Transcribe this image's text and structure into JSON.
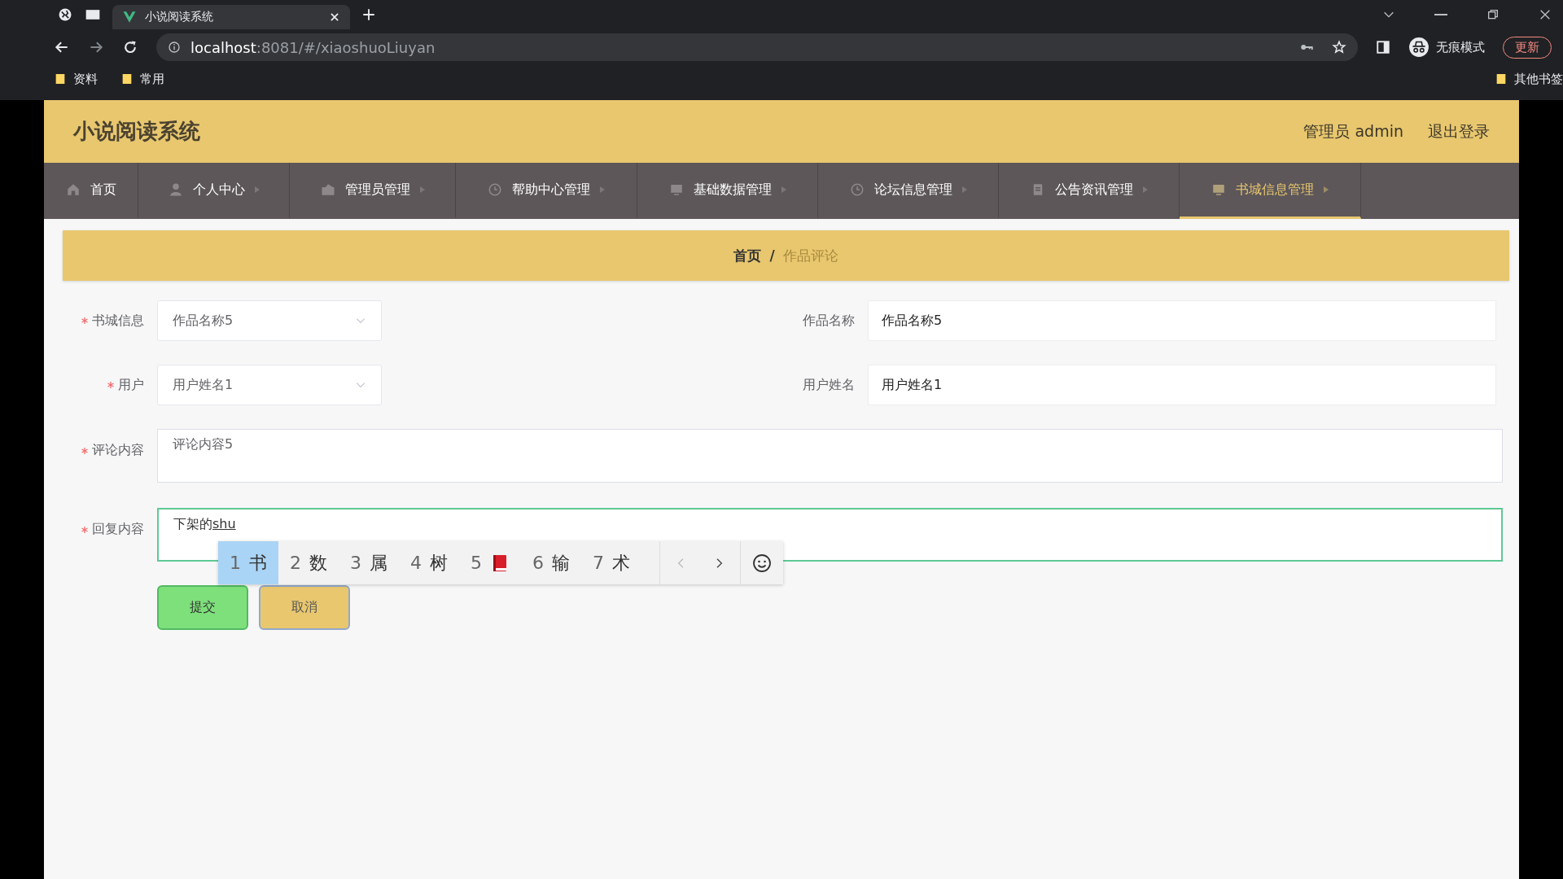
{
  "browser": {
    "tab_title": "小说阅读系统",
    "url_host": "localhost",
    "url_rest": ":8081/#/xiaoshuoLiuyan",
    "incognito_label": "无痕模式",
    "update_button": "更新",
    "bookmarks": [
      {
        "label": "资料"
      },
      {
        "label": "常用"
      }
    ],
    "other_bookmarks": "其他书签"
  },
  "header": {
    "title": "小说阅读系统",
    "user": "管理员 admin",
    "logout": "退出登录"
  },
  "nav": [
    {
      "label": "首页",
      "selected": false,
      "has_arrow": false
    },
    {
      "label": "个人中心",
      "selected": false,
      "has_arrow": true
    },
    {
      "label": "管理员管理",
      "selected": false,
      "has_arrow": true
    },
    {
      "label": "帮助中心管理",
      "selected": false,
      "has_arrow": true
    },
    {
      "label": "基础数据管理",
      "selected": false,
      "has_arrow": true
    },
    {
      "label": "论坛信息管理",
      "selected": false,
      "has_arrow": true
    },
    {
      "label": "公告资讯管理",
      "selected": false,
      "has_arrow": true
    },
    {
      "label": "书城信息管理",
      "selected": true,
      "has_arrow": true
    }
  ],
  "breadcrumb": [
    {
      "label": "首页",
      "current": false
    },
    {
      "label": "作品评论",
      "current": true
    }
  ],
  "breadcrumb_separator": "/",
  "form": {
    "rows": [
      {
        "left": {
          "label": "书城信息",
          "required": true,
          "kind": "select",
          "value": "作品名称5"
        },
        "right": {
          "label": "作品名称",
          "kind": "input",
          "value": "作品名称5"
        }
      },
      {
        "left": {
          "label": "用户",
          "required": true,
          "kind": "select",
          "value": "用户姓名1"
        },
        "right": {
          "label": "用户姓名",
          "kind": "input",
          "value": "用户姓名1"
        }
      }
    ],
    "textareas": [
      {
        "label": "评论内容",
        "required": true,
        "value": "评论内容5",
        "focused": false
      },
      {
        "label": "回复内容",
        "required": true,
        "value": "下架的",
        "composing": "shu",
        "focused": true
      }
    ],
    "buttons": [
      {
        "label": "提交",
        "kind": "submit"
      },
      {
        "label": "取消",
        "kind": "cancel"
      }
    ]
  },
  "ime": {
    "candidates": [
      {
        "number": "1",
        "kind": "text",
        "text": "书",
        "selected": true
      },
      {
        "number": "2",
        "kind": "text",
        "text": "数",
        "selected": false
      },
      {
        "number": "3",
        "kind": "text",
        "text": "属",
        "selected": false
      },
      {
        "number": "4",
        "kind": "text",
        "text": "树",
        "selected": false
      },
      {
        "number": "5",
        "kind": "icon",
        "selected": false
      },
      {
        "number": "6",
        "kind": "text",
        "text": "输",
        "selected": false
      },
      {
        "number": "7",
        "kind": "text",
        "text": "术",
        "selected": false
      }
    ]
  }
}
